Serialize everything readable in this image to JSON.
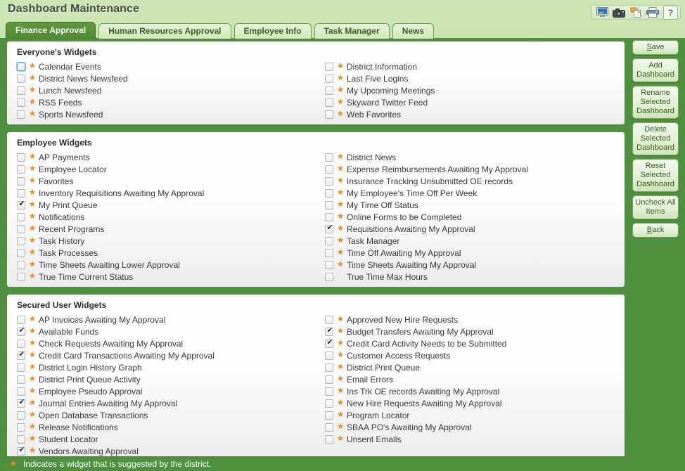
{
  "header": {
    "title": "Dashboard Maintenance",
    "toolbar": [
      {
        "name": "monitor-icon",
        "label": "Monitor"
      },
      {
        "name": "camera-icon",
        "label": "Camera"
      },
      {
        "name": "copy-paste-icon",
        "label": "Copy"
      },
      {
        "name": "printer-icon",
        "label": "Print"
      },
      {
        "name": "help-icon",
        "label": "?"
      }
    ]
  },
  "tabs": [
    {
      "label": "Finance Approval",
      "active": true
    },
    {
      "label": "Human Resources Approval",
      "active": false
    },
    {
      "label": "Employee Info",
      "active": false
    },
    {
      "label": "Task Manager",
      "active": false
    },
    {
      "label": "News",
      "active": false
    }
  ],
  "panels": [
    {
      "title": "Everyone's Widgets",
      "left": [
        {
          "label": "Calendar Events",
          "checked": false,
          "star": true,
          "focused": true
        },
        {
          "label": "District News Newsfeed",
          "checked": false,
          "star": true
        },
        {
          "label": "Lunch Newsfeed",
          "checked": false,
          "star": true
        },
        {
          "label": "RSS Feeds",
          "checked": false,
          "star": true
        },
        {
          "label": "Sports Newsfeed",
          "checked": false,
          "star": true
        }
      ],
      "right": [
        {
          "label": "District Information",
          "checked": false,
          "star": true
        },
        {
          "label": "Last Five Logins",
          "checked": false,
          "star": true
        },
        {
          "label": "My Upcoming Meetings",
          "checked": false,
          "star": true
        },
        {
          "label": "Skyward Twitter Feed",
          "checked": false,
          "star": true
        },
        {
          "label": "Web Favorites",
          "checked": false,
          "star": true
        }
      ]
    },
    {
      "title": "Employee Widgets",
      "left": [
        {
          "label": "AP Payments",
          "checked": false,
          "star": true
        },
        {
          "label": "Employee Locator",
          "checked": false,
          "star": true
        },
        {
          "label": "Favorites",
          "checked": false,
          "star": true
        },
        {
          "label": "Inventory Requisitions Awaiting My Approval",
          "checked": false,
          "star": true
        },
        {
          "label": "My Print Queue",
          "checked": true,
          "star": true
        },
        {
          "label": "Notifications",
          "checked": false,
          "star": true
        },
        {
          "label": "Recent Programs",
          "checked": false,
          "star": true
        },
        {
          "label": "Task History",
          "checked": false,
          "star": true
        },
        {
          "label": "Task Processes",
          "checked": false,
          "star": true
        },
        {
          "label": "Time Sheets Awaiting Lower Approval",
          "checked": false,
          "star": true
        },
        {
          "label": "True Time Current Status",
          "checked": false,
          "star": true
        }
      ],
      "right": [
        {
          "label": "District News",
          "checked": false,
          "star": true
        },
        {
          "label": "Expense Reimbursements Awaiting My Approval",
          "checked": false,
          "star": true
        },
        {
          "label": "Insurance Tracking Unsubmitted OE records",
          "checked": false,
          "star": true
        },
        {
          "label": "My Employee's Time Off Per Week",
          "checked": false,
          "star": true
        },
        {
          "label": "My Time Off Status",
          "checked": false,
          "star": true
        },
        {
          "label": "Online Forms to be Completed",
          "checked": false,
          "star": true
        },
        {
          "label": "Requisitions Awaiting My Approval",
          "checked": true,
          "star": true
        },
        {
          "label": "Task Manager",
          "checked": false,
          "star": true
        },
        {
          "label": "Time Off Awaiting My Approval",
          "checked": false,
          "star": true
        },
        {
          "label": "Time Sheets Awaiting My Approval",
          "checked": false,
          "star": true
        },
        {
          "label": "True Time Max Hours",
          "checked": false,
          "star": false
        }
      ]
    },
    {
      "title": "Secured User Widgets",
      "left": [
        {
          "label": "AP Invoices Awaiting My Approval",
          "checked": false,
          "star": true
        },
        {
          "label": "Available Funds",
          "checked": true,
          "star": true
        },
        {
          "label": "Check Requests Awaiting My Approval",
          "checked": false,
          "star": true
        },
        {
          "label": "Credit Card Transactions Awaiting My Approval",
          "checked": true,
          "star": true
        },
        {
          "label": "District Login History Graph",
          "checked": false,
          "star": true
        },
        {
          "label": "District Print Queue Activity",
          "checked": false,
          "star": true
        },
        {
          "label": "Employee Pseudo Approval",
          "checked": false,
          "star": true
        },
        {
          "label": "Journal Entries Awaiting My Approval",
          "checked": true,
          "star": true
        },
        {
          "label": "Open Database Transactions",
          "checked": false,
          "star": true
        },
        {
          "label": "Release Notifications",
          "checked": false,
          "star": true
        },
        {
          "label": "Student Locator",
          "checked": false,
          "star": true
        },
        {
          "label": "Vendors Awaiting Approval",
          "checked": true,
          "star": true
        }
      ],
      "right": [
        {
          "label": "Approved New Hire Requests",
          "checked": false,
          "star": true
        },
        {
          "label": "Budget Transfers Awaiting My Approval",
          "checked": true,
          "star": true
        },
        {
          "label": "Credit Card Activity Needs to be Submitted",
          "checked": true,
          "star": true
        },
        {
          "label": "Customer Access Requests",
          "checked": false,
          "star": true
        },
        {
          "label": "District Print Queue",
          "checked": false,
          "star": true
        },
        {
          "label": "Email Errors",
          "checked": false,
          "star": true
        },
        {
          "label": "Ins Trk OE records Awaiting My Approval",
          "checked": false,
          "star": true
        },
        {
          "label": "New Hire Requests Awaiting My Approval",
          "checked": false,
          "star": true
        },
        {
          "label": "Program Locator",
          "checked": false,
          "star": true
        },
        {
          "label": "SBAA PO's Awaiting My Approval",
          "checked": false,
          "star": true
        },
        {
          "label": "Unsent Emails",
          "checked": false,
          "star": true
        }
      ]
    }
  ],
  "rail_buttons": [
    {
      "name": "save-button",
      "label": "Save",
      "accel": "S"
    },
    {
      "name": "add-dashboard-button",
      "label": "Add Dashboard",
      "accel": ""
    },
    {
      "name": "rename-selected-dashboard-button",
      "label": "Rename Selected Dashboard",
      "accel": ""
    },
    {
      "name": "delete-selected-dashboard-button",
      "label": "Delete Selected Dashboard",
      "accel": ""
    },
    {
      "name": "reset-selected-dashboard-button",
      "label": "Reset Selected Dashboard",
      "accel": ""
    },
    {
      "name": "uncheck-all-items-button",
      "label": "Uncheck All Items",
      "accel": ""
    },
    {
      "name": "back-button",
      "label": "Back",
      "accel": "B"
    }
  ],
  "legend": {
    "star": "★",
    "text": "Indicates a widget that is suggested by the district."
  },
  "colors": {
    "green_frame": "#4f8f3f",
    "header_green": "#cce5b4",
    "star_orange": "#f08a1c",
    "tab_active_bg": "#4f8a32"
  }
}
